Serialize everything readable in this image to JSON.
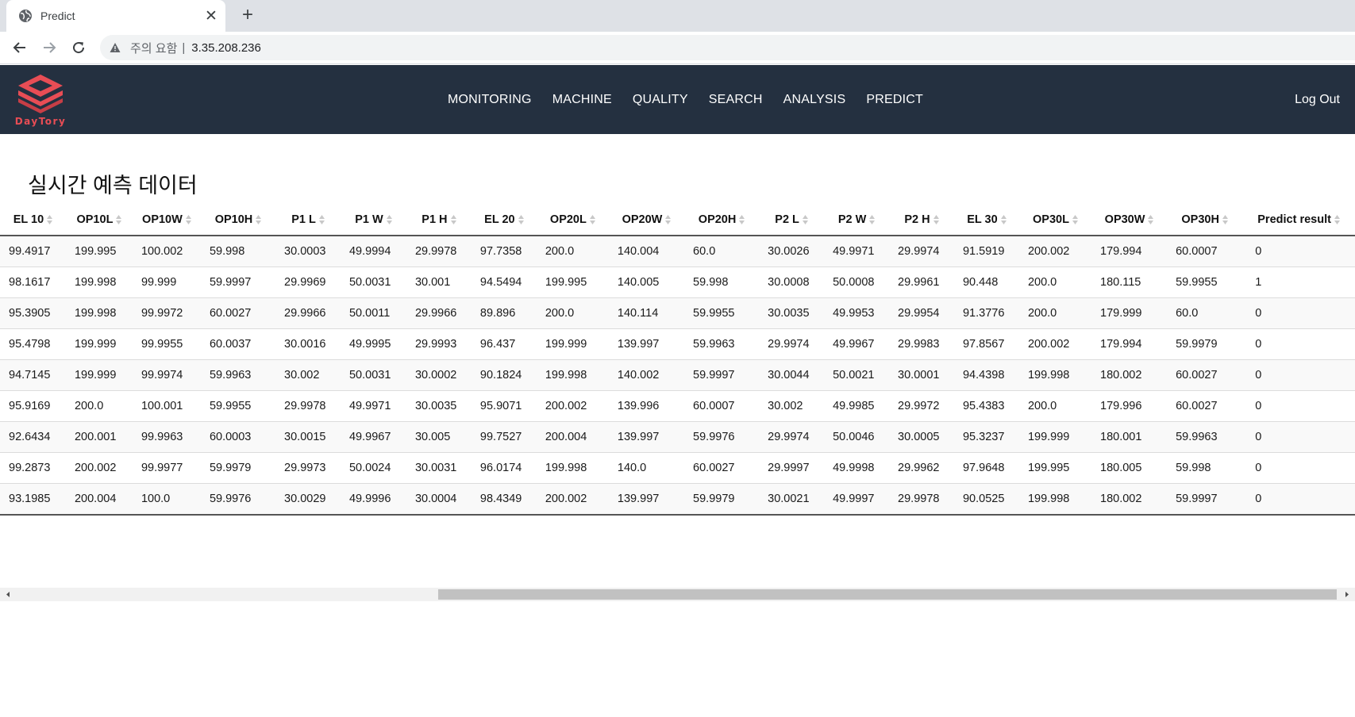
{
  "browser": {
    "tab_title": "Predict",
    "security_warning": "주의 요함",
    "url": "3.35.208.236"
  },
  "app": {
    "logo_text": "DayTory",
    "brand_color": "#e84d55",
    "navbar_bg": "#243040",
    "menu": [
      "MONITORING",
      "MACHINE",
      "QUALITY",
      "SEARCH",
      "ANALYSIS",
      "PREDICT"
    ],
    "logout": "Log Out"
  },
  "page": {
    "title": "실시간 예측 데이터"
  },
  "table": {
    "columns": [
      "EL 10",
      "OP10L",
      "OP10W",
      "OP10H",
      "P1 L",
      "P1 W",
      "P1 H",
      "EL 20",
      "OP20L",
      "OP20W",
      "OP20H",
      "P2 L",
      "P2 W",
      "P2 H",
      "EL 30",
      "OP30L",
      "OP30W",
      "OP30H",
      "Predict result"
    ],
    "rows": [
      [
        "99.4917",
        "199.995",
        "100.002",
        "59.998",
        "30.0003",
        "49.9994",
        "29.9978",
        "97.7358",
        "200.0",
        "140.004",
        "60.0",
        "30.0026",
        "49.9971",
        "29.9974",
        "91.5919",
        "200.002",
        "179.994",
        "60.0007",
        "0"
      ],
      [
        "98.1617",
        "199.998",
        "99.999",
        "59.9997",
        "29.9969",
        "50.0031",
        "30.001",
        "94.5494",
        "199.995",
        "140.005",
        "59.998",
        "30.0008",
        "50.0008",
        "29.9961",
        "90.448",
        "200.0",
        "180.115",
        "59.9955",
        "1"
      ],
      [
        "95.3905",
        "199.998",
        "99.9972",
        "60.0027",
        "29.9966",
        "50.0011",
        "29.9966",
        "89.896",
        "200.0",
        "140.114",
        "59.9955",
        "30.0035",
        "49.9953",
        "29.9954",
        "91.3776",
        "200.0",
        "179.999",
        "60.0",
        "0"
      ],
      [
        "95.4798",
        "199.999",
        "99.9955",
        "60.0037",
        "30.0016",
        "49.9995",
        "29.9993",
        "96.437",
        "199.999",
        "139.997",
        "59.9963",
        "29.9974",
        "49.9967",
        "29.9983",
        "97.8567",
        "200.002",
        "179.994",
        "59.9979",
        "0"
      ],
      [
        "94.7145",
        "199.999",
        "99.9974",
        "59.9963",
        "30.002",
        "50.0031",
        "30.0002",
        "90.1824",
        "199.998",
        "140.002",
        "59.9997",
        "30.0044",
        "50.0021",
        "30.0001",
        "94.4398",
        "199.998",
        "180.002",
        "60.0027",
        "0"
      ],
      [
        "95.9169",
        "200.0",
        "100.001",
        "59.9955",
        "29.9978",
        "49.9971",
        "30.0035",
        "95.9071",
        "200.002",
        "139.996",
        "60.0007",
        "30.002",
        "49.9985",
        "29.9972",
        "95.4383",
        "200.0",
        "179.996",
        "60.0027",
        "0"
      ],
      [
        "92.6434",
        "200.001",
        "99.9963",
        "60.0003",
        "30.0015",
        "49.9967",
        "30.005",
        "99.7527",
        "200.004",
        "139.997",
        "59.9976",
        "29.9974",
        "50.0046",
        "30.0005",
        "95.3237",
        "199.999",
        "180.001",
        "59.9963",
        "0"
      ],
      [
        "99.2873",
        "200.002",
        "99.9977",
        "59.9979",
        "29.9973",
        "50.0024",
        "30.0031",
        "96.0174",
        "199.998",
        "140.0",
        "60.0027",
        "29.9997",
        "49.9998",
        "29.9962",
        "97.9648",
        "199.995",
        "180.005",
        "59.998",
        "0"
      ],
      [
        "93.1985",
        "200.004",
        "100.0",
        "59.9976",
        "30.0029",
        "49.9996",
        "30.0004",
        "98.4349",
        "200.002",
        "139.997",
        "59.9979",
        "30.0021",
        "49.9997",
        "29.9978",
        "90.0525",
        "199.998",
        "180.002",
        "59.9997",
        "0"
      ]
    ]
  }
}
